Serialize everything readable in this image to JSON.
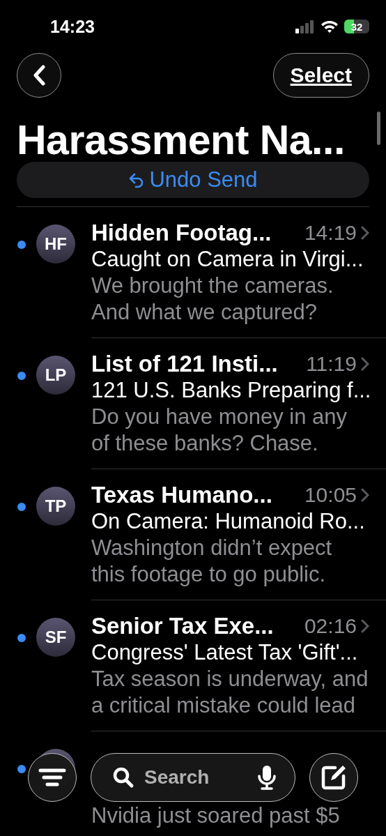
{
  "status_bar": {
    "time": "14:23",
    "battery": "32"
  },
  "nav": {
    "select": "Select"
  },
  "title": "Harassment Na...",
  "undo": {
    "label": "Undo Send"
  },
  "messages": [
    {
      "initials": "HF",
      "sender": "Hidden Footag...",
      "time": "14:19",
      "subject": "Caught on Camera in Virgi...",
      "preview": "We brought the cameras. And what we captured?",
      "unread": true
    },
    {
      "initials": "LP",
      "sender": "List of 121 Insti...",
      "time": "11:19",
      "subject": "121 U.S. Banks Preparing f...",
      "preview": "Do you have money in any of these banks? Chase.",
      "unread": true
    },
    {
      "initials": "TP",
      "sender": "Texas Humano...",
      "time": "10:05",
      "subject": "On Camera: Humanoid Ro...",
      "preview": "Washington didn’t expect this footage to go public.",
      "unread": true
    },
    {
      "initials": "SF",
      "sender": "Senior Tax Exe...",
      "time": "02:16",
      "subject": "Congress' Latest Tax 'Gift'...",
      "preview": "Tax season is underway, and a critical mistake could lead",
      "unread": true
    },
    {
      "preview": "Nvidia just soared past $5",
      "unread": true
    }
  ],
  "toolbar": {
    "search_placeholder": "Search"
  }
}
